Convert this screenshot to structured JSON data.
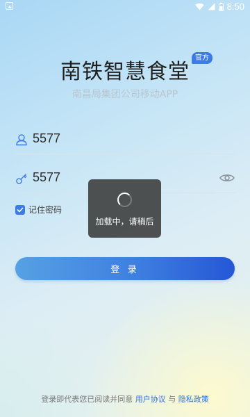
{
  "status_bar": {
    "time": "8:50"
  },
  "header": {
    "title": "南铁智慧食堂",
    "badge": "官方",
    "subtitle": "南昌局集团公司移动APP"
  },
  "form": {
    "username": {
      "value": "5577",
      "icon": "user-icon"
    },
    "password": {
      "value": "5577",
      "icon": "key-icon",
      "toggle_icon": "eye-icon"
    },
    "remember": {
      "label": "记住密码",
      "checked": true
    },
    "login_label": "登 录"
  },
  "loading": {
    "text": "加载中，请稍后"
  },
  "agreement": {
    "prefix": "登录即代表您已阅读并同意 ",
    "user_agreement": "用户协议",
    "and": " 与 ",
    "privacy_policy": "隐私政策"
  },
  "colors": {
    "accent": "#3d7be6",
    "button_start": "#56a1e4",
    "button_end": "#2557d6"
  }
}
